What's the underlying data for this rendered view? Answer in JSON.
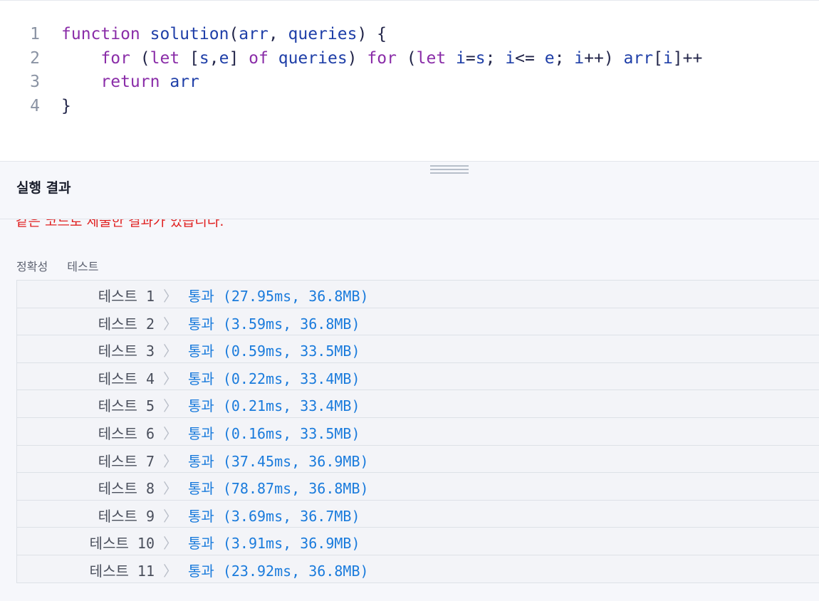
{
  "editor": {
    "line_numbers": [
      "1",
      "2",
      "3",
      "4"
    ],
    "lines": [
      [
        {
          "t": "function",
          "c": "kw"
        },
        {
          "t": " ",
          "c": "pl"
        },
        {
          "t": "solution",
          "c": "fn"
        },
        {
          "t": "(",
          "c": "pl"
        },
        {
          "t": "arr",
          "c": "fn"
        },
        {
          "t": ", ",
          "c": "pl"
        },
        {
          "t": "queries",
          "c": "fn"
        },
        {
          "t": ") {",
          "c": "pl"
        }
      ],
      [
        {
          "t": "    ",
          "c": "pl"
        },
        {
          "t": "for",
          "c": "kw"
        },
        {
          "t": " (",
          "c": "pl"
        },
        {
          "t": "let",
          "c": "kw"
        },
        {
          "t": " [",
          "c": "pl"
        },
        {
          "t": "s",
          "c": "fn"
        },
        {
          "t": ",",
          "c": "pl"
        },
        {
          "t": "e",
          "c": "fn"
        },
        {
          "t": "] ",
          "c": "pl"
        },
        {
          "t": "of",
          "c": "kw"
        },
        {
          "t": " ",
          "c": "pl"
        },
        {
          "t": "queries",
          "c": "fn"
        },
        {
          "t": ") ",
          "c": "pl"
        },
        {
          "t": "for",
          "c": "kw"
        },
        {
          "t": " (",
          "c": "pl"
        },
        {
          "t": "let",
          "c": "kw"
        },
        {
          "t": " ",
          "c": "pl"
        },
        {
          "t": "i",
          "c": "fn"
        },
        {
          "t": "=",
          "c": "pl"
        },
        {
          "t": "s",
          "c": "fn"
        },
        {
          "t": "; ",
          "c": "pl"
        },
        {
          "t": "i",
          "c": "fn"
        },
        {
          "t": "<= ",
          "c": "pl"
        },
        {
          "t": "e",
          "c": "fn"
        },
        {
          "t": "; ",
          "c": "pl"
        },
        {
          "t": "i",
          "c": "fn"
        },
        {
          "t": "++) ",
          "c": "pl"
        },
        {
          "t": "arr",
          "c": "fn"
        },
        {
          "t": "[",
          "c": "pl"
        },
        {
          "t": "i",
          "c": "fn"
        },
        {
          "t": "]++",
          "c": "pl"
        }
      ],
      [
        {
          "t": "    ",
          "c": "pl"
        },
        {
          "t": "return",
          "c": "kw"
        },
        {
          "t": " ",
          "c": "pl"
        },
        {
          "t": "arr",
          "c": "fn"
        }
      ],
      [
        {
          "t": "}",
          "c": "pl"
        }
      ]
    ]
  },
  "result_panel": {
    "title": "실행 결과",
    "partial_message": "같은 코드로 제출한 결과가 있습니다.",
    "tabs": [
      "정확성",
      "테스트"
    ]
  },
  "tests": [
    {
      "name": "테스트 1",
      "result": "통과 (27.95ms, 36.8MB)"
    },
    {
      "name": "테스트 2",
      "result": "통과 (3.59ms, 36.8MB)"
    },
    {
      "name": "테스트 3",
      "result": "통과 (0.59ms, 33.5MB)"
    },
    {
      "name": "테스트 4",
      "result": "통과 (0.22ms, 33.4MB)"
    },
    {
      "name": "테스트 5",
      "result": "통과 (0.21ms, 33.4MB)"
    },
    {
      "name": "테스트 6",
      "result": "통과 (0.16ms, 33.5MB)"
    },
    {
      "name": "테스트 7",
      "result": "통과 (37.45ms, 36.9MB)"
    },
    {
      "name": "테스트 8",
      "result": "통과 (78.87ms, 36.8MB)"
    },
    {
      "name": "테스트 9",
      "result": "통과 (3.69ms, 36.7MB)"
    },
    {
      "name": "테스트 10",
      "result": "통과 (3.91ms, 36.9MB)"
    },
    {
      "name": "테스트 11",
      "result": "통과 (23.92ms, 36.8MB)"
    }
  ],
  "colors": {
    "pass": "#1a7bdc",
    "keyword": "#8a2da8",
    "identifier": "#1f3fa8",
    "error": "#e02020"
  }
}
